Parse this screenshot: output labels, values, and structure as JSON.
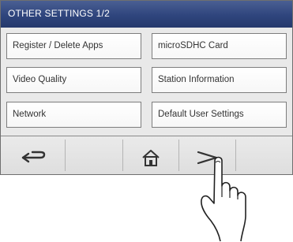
{
  "header": {
    "title": "OTHER SETTINGS  1/2"
  },
  "menu": {
    "left": [
      {
        "label": "Register / Delete Apps"
      },
      {
        "label": "Video Quality"
      },
      {
        "label": "Network"
      }
    ],
    "right": [
      {
        "label": "microSDHC Card"
      },
      {
        "label": "Station Information"
      },
      {
        "label": "Default User Settings"
      }
    ]
  },
  "footer": {
    "icons": [
      "back-arrow-icon",
      "home-icon",
      "next-arrow-icon"
    ]
  },
  "colors": {
    "header_bg": "#2f457d",
    "header_text": "#ffffff",
    "content_bg": "#e9e9e9",
    "button_border": "#7d7d7d"
  }
}
